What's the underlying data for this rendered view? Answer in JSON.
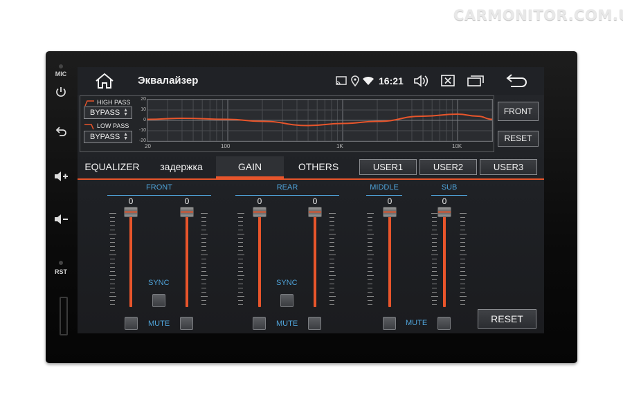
{
  "watermark": "CARMONITOR.COM.UA",
  "side": {
    "mic_label": "MIC",
    "rst_label": "RST"
  },
  "topbar": {
    "title": "Эквалайзер",
    "time": "16:21"
  },
  "filters": {
    "high_pass_label": "HIGH PASS",
    "high_pass_value": "BYPASS",
    "low_pass_label": "LOW PASS",
    "low_pass_value": "BYPASS"
  },
  "graph": {
    "y_ticks": [
      "20",
      "10",
      "0",
      "-10",
      "-20"
    ],
    "x_ticks": [
      "20",
      "100",
      "1K",
      "10K"
    ]
  },
  "chart_data": {
    "type": "line",
    "x": [
      20,
      40,
      100,
      200,
      500,
      1000,
      2000,
      5000,
      10000,
      15000,
      20000
    ],
    "values": [
      1,
      2,
      1,
      -1,
      -5,
      -3,
      -1,
      4,
      6,
      4,
      1
    ],
    "ylim": [
      -20,
      20
    ],
    "x_scale": "log",
    "xlim": [
      20,
      20000
    ],
    "grid": true,
    "line_color": "#e8552b"
  },
  "side_buttons": {
    "front": "FRONT",
    "reset": "RESET"
  },
  "tabs": [
    {
      "label": "EQUALIZER",
      "active": false
    },
    {
      "label": "задержка",
      "active": false
    },
    {
      "label": "GAIN",
      "active": true
    },
    {
      "label": "OTHERS",
      "active": false
    }
  ],
  "user_presets": [
    "USER1",
    "USER2",
    "USER3"
  ],
  "groups": [
    {
      "label": "FRONT"
    },
    {
      "label": "REAR"
    },
    {
      "label": "MIDDLE"
    },
    {
      "label": "SUB"
    }
  ],
  "sliders": [
    {
      "id": "front-left",
      "value": "0"
    },
    {
      "id": "front-right",
      "value": "0"
    },
    {
      "id": "rear-left",
      "value": "0"
    },
    {
      "id": "rear-right",
      "value": "0"
    },
    {
      "id": "middle",
      "value": "0"
    },
    {
      "id": "sub",
      "value": "0"
    }
  ],
  "labels": {
    "sync": "SYNC",
    "mute": "MUTE"
  },
  "reset_button": "RESET",
  "colors": {
    "accent": "#e8552b",
    "label_blue": "#4fa3d9",
    "screen_bg": "#1e2024"
  }
}
